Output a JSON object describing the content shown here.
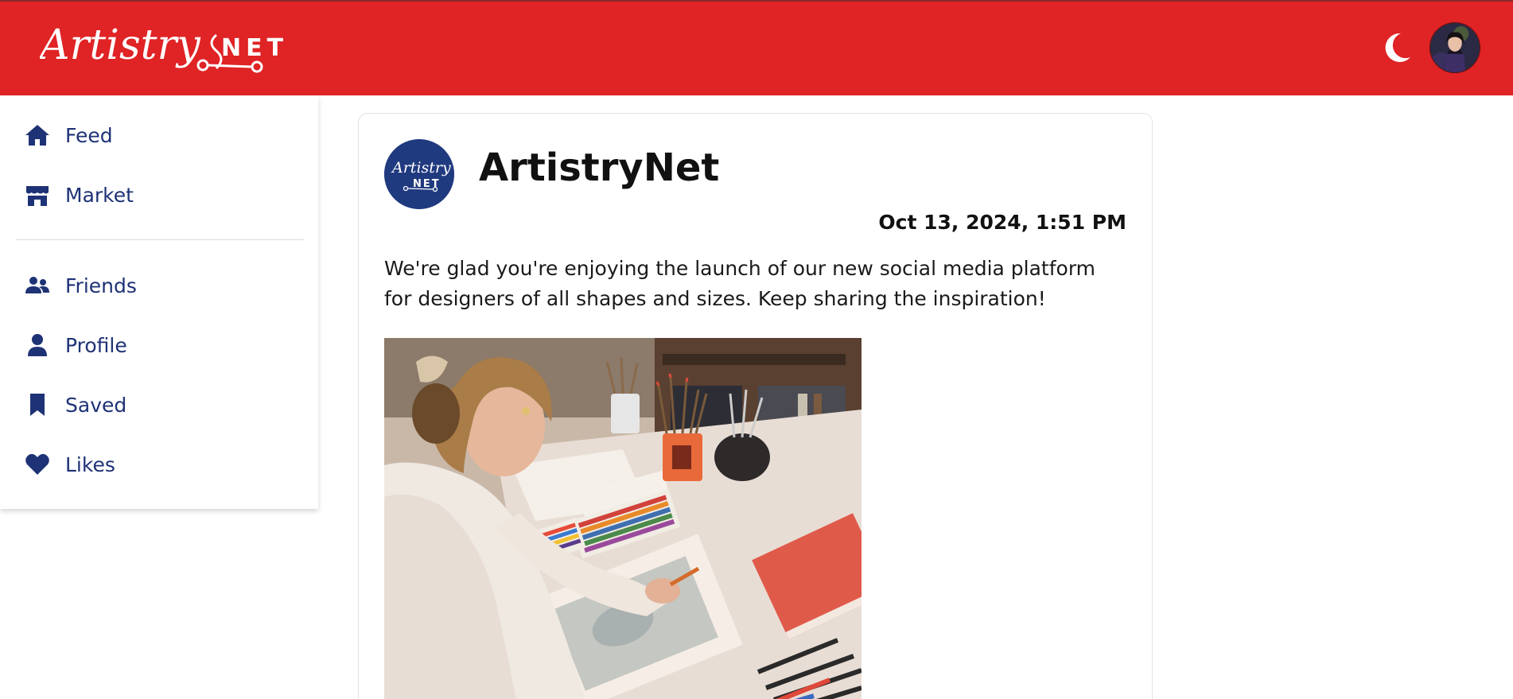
{
  "header": {
    "logo_text": "Artistry NET",
    "theme_toggle_icon": "moon-icon",
    "avatar_icon": "user-avatar"
  },
  "sidebar": {
    "items": [
      {
        "label": "Feed",
        "icon": "home-icon"
      },
      {
        "label": "Market",
        "icon": "storefront-icon"
      },
      {
        "label": "Friends",
        "icon": "users-icon"
      },
      {
        "label": "Profile",
        "icon": "user-icon"
      },
      {
        "label": "Saved",
        "icon": "bookmark-icon"
      },
      {
        "label": "Likes",
        "icon": "heart-icon"
      }
    ]
  },
  "post": {
    "author": "ArtistryNet",
    "avatar_text": "Artistry NET",
    "date": "Oct 13, 2024, 1:51 PM",
    "text": "We're glad you're enjoying the launch of our new social media platform for designers of all shapes and sizes. Keep sharing the inspiration!",
    "image_icon": "post-photo"
  },
  "colors": {
    "header_bg": "#e02325",
    "nav_text": "#1e3276",
    "avatar_bg": "#203a80"
  }
}
